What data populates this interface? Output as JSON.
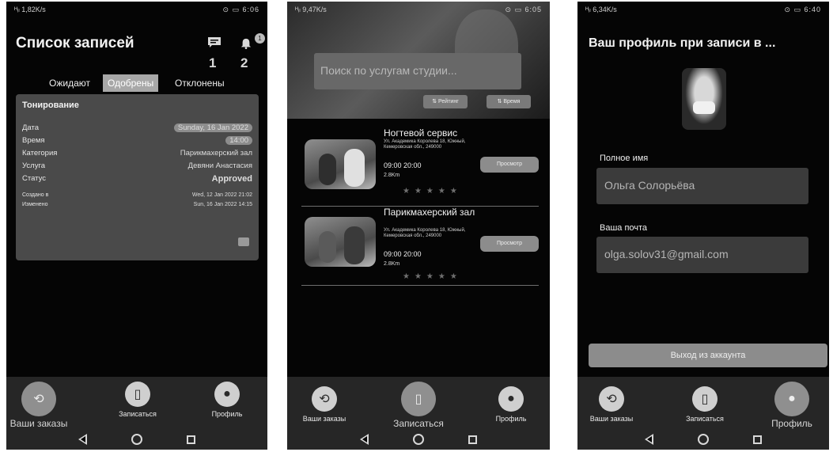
{
  "screen1": {
    "status": {
      "left": "ᴴᵢₗ 1,82K/s",
      "right": "⊙ ▭ 6:06"
    },
    "title": "Список записей",
    "counters": {
      "msg": "1",
      "notif": "2",
      "badge": "1"
    },
    "tabs": [
      {
        "label": "Ожидают",
        "selected": false
      },
      {
        "label": "Одобрены",
        "selected": true
      },
      {
        "label": "Отклонены",
        "selected": false
      }
    ],
    "card": {
      "title": "Тонирование",
      "rows": [
        {
          "key": "Дата",
          "value": "Sunday, 16 Jan 2022"
        },
        {
          "key": "Время",
          "value": "14:00"
        },
        {
          "key": "Категория",
          "value": "Парикмахерский зал"
        },
        {
          "key": "Услуга",
          "value": "Девяни Анастасия"
        },
        {
          "key": "Статус",
          "value": "Approved"
        },
        {
          "key": "Создано в",
          "value": "Wed, 12 Jan 2022 21:02"
        },
        {
          "key": "Изменено",
          "value": "Sun, 16 Jan 2022 14:15"
        }
      ]
    },
    "nav": [
      "Ваши заказы",
      "Записаться",
      "Профиль"
    ]
  },
  "screen2": {
    "status": {
      "left": "ᴴᵢₗ 9,47K/s",
      "right": "⊙ ▭ 6:05"
    },
    "search_placeholder": "Поиск по услугам студии...",
    "filters": [
      "⇅ Рейтинг",
      "⇅ Время"
    ],
    "services": [
      {
        "name": "Ногтевой сервис",
        "address": "Ул. Академика Королева 18, Южный, Кемеровская обл., 249000",
        "time": "09:00  20:00",
        "distance": "2.8Km",
        "button": "Просмотр"
      },
      {
        "name": "Парикмахерский зал",
        "address": "Ул. Академика Королева 18, Южный, Кемеровская обл., 249000",
        "time": "09:00  20:00",
        "distance": "2.8Km",
        "button": "Просмотр"
      }
    ],
    "stars": "★★★★★",
    "nav": [
      "Ваши заказы",
      "Записаться",
      "Профиль"
    ]
  },
  "screen3": {
    "status": {
      "left": "ᴴᵢₗ 6,34K/s",
      "right": "⊙ ▭ 6:40"
    },
    "title": "Ваш профиль при записи в ...",
    "name_label": "Полное имя",
    "name_value": "Ольга Солорьёва",
    "email_label": "Ваша почта",
    "email_value": "olga.solov31@gmail.com",
    "logout": "Выход из аккаунта",
    "nav": [
      "Ваши заказы",
      "Записаться",
      "Профиль"
    ]
  }
}
